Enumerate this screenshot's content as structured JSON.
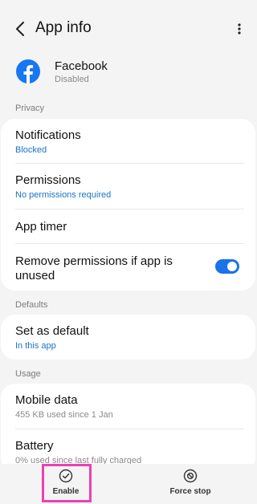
{
  "header": {
    "title": "App info"
  },
  "app": {
    "name": "Facebook",
    "status": "Disabled"
  },
  "sections": {
    "privacy": "Privacy",
    "defaults": "Defaults",
    "usage": "Usage"
  },
  "privacy_items": {
    "notifications": {
      "title": "Notifications",
      "sub": "Blocked"
    },
    "permissions": {
      "title": "Permissions",
      "sub": "No permissions required"
    },
    "app_timer": {
      "title": "App timer"
    },
    "remove_permissions": {
      "title": "Remove permissions if app is unused",
      "enabled": true
    }
  },
  "defaults_items": {
    "set_default": {
      "title": "Set as default",
      "sub": "In this app"
    }
  },
  "usage_items": {
    "mobile_data": {
      "title": "Mobile data",
      "sub": "455 KB used since 1 Jan"
    },
    "battery": {
      "title": "Battery",
      "sub": "0% used since last fully charged"
    }
  },
  "bottom": {
    "enable": "Enable",
    "force_stop": "Force stop"
  },
  "colors": {
    "accent": "#1a73e8",
    "link": "#1a73c8",
    "highlight": "#ee3fb6",
    "facebook": "#1877f2"
  }
}
